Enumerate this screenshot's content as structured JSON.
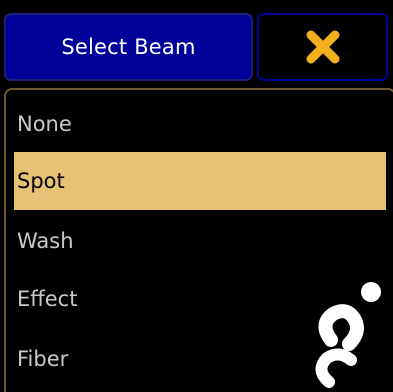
{
  "header": {
    "title": "Select Beam",
    "close_icon": "close-x-icon"
  },
  "colors": {
    "title_bg": "#000099",
    "panel_border": "#6e5a2c",
    "selected_bg": "#e6c176",
    "close_icon": "#f2b01e",
    "item_text": "#c9c9c9"
  },
  "list": {
    "items": [
      {
        "label": "None",
        "selected": false
      },
      {
        "label": "Spot",
        "selected": true
      },
      {
        "label": "Wash",
        "selected": false
      },
      {
        "label": "Effect",
        "selected": false
      },
      {
        "label": "Fiber",
        "selected": false
      }
    ]
  }
}
